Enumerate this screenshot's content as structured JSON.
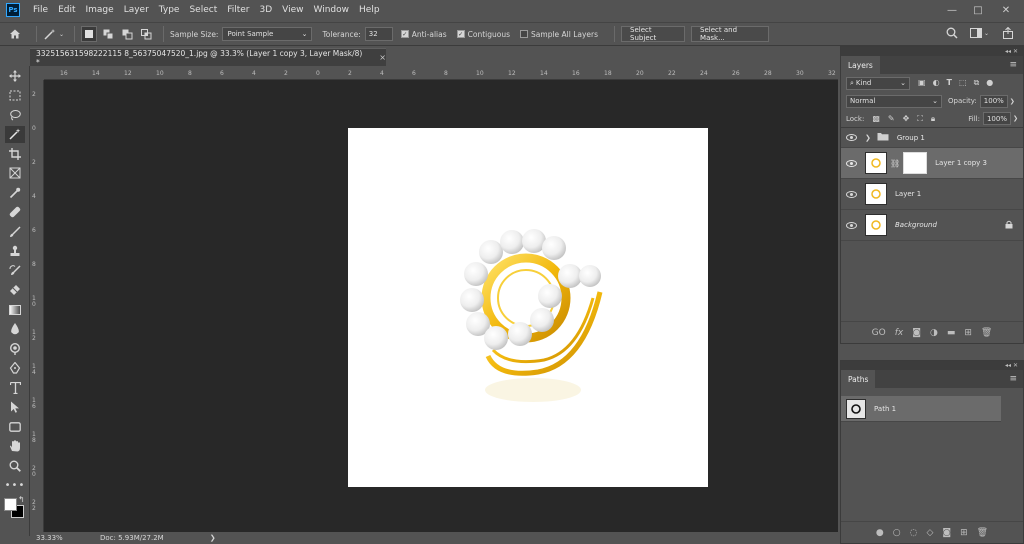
{
  "app": {
    "logo": "Ps"
  },
  "menu": [
    "File",
    "Edit",
    "Image",
    "Layer",
    "Type",
    "Select",
    "Filter",
    "3D",
    "View",
    "Window",
    "Help"
  ],
  "window_controls": {
    "minimize": "—",
    "restore": "□",
    "close": "✕"
  },
  "options": {
    "sample_size_label": "Sample Size:",
    "sample_size_value": "Point Sample",
    "tolerance_label": "Tolerance:",
    "tolerance_value": "32",
    "anti_alias": "Anti-alias",
    "contiguous": "Contiguous",
    "sample_all_layers": "Sample All Layers",
    "select_subject": "Select Subject",
    "select_and_mask": "Select and Mask..."
  },
  "document": {
    "tab_title": "332515631598222115 8_56375047520_1.jpg @ 33.3% (Layer 1 copy 3, Layer Mask/8) *",
    "close": "×"
  },
  "ruler_h": [
    "16",
    "14",
    "12",
    "10",
    "8",
    "6",
    "4",
    "2",
    "0",
    "2",
    "4",
    "6",
    "8",
    "10",
    "12",
    "14",
    "16",
    "18",
    "20",
    "22",
    "24",
    "26",
    "28",
    "30",
    "32",
    "34"
  ],
  "ruler_v": [
    "2",
    "0",
    "2",
    "4",
    "6",
    "8",
    "1 0",
    "1 2",
    "1 4",
    "1 6",
    "1 8",
    "2 0",
    "2 2",
    "2 4"
  ],
  "status": {
    "zoom": "33.33%",
    "doc": "Doc: 5.93M/27.2M",
    "arrow": "❯"
  },
  "layers_panel": {
    "tab": "Layers",
    "filter_kind": "Kind",
    "blend_mode": "Normal",
    "opacity_label": "Opacity:",
    "opacity_value": "100%",
    "lock_label": "Lock:",
    "fill_label": "Fill:",
    "fill_value": "100%",
    "layers": [
      {
        "name": "Group 1",
        "kind": "group"
      },
      {
        "name": "Layer 1 copy 3",
        "kind": "masked",
        "selected": true
      },
      {
        "name": "Layer 1",
        "kind": "normal"
      },
      {
        "name": "Background",
        "kind": "background"
      }
    ],
    "footer": {
      "link": "GO",
      "fx": "fx"
    }
  },
  "paths_panel": {
    "tab": "Paths",
    "paths": [
      {
        "name": "Path 1"
      }
    ]
  },
  "colors": {
    "accent": "#31a8ff",
    "ring_gold": "#f2c01a",
    "pearl": "#f3f3f3"
  }
}
